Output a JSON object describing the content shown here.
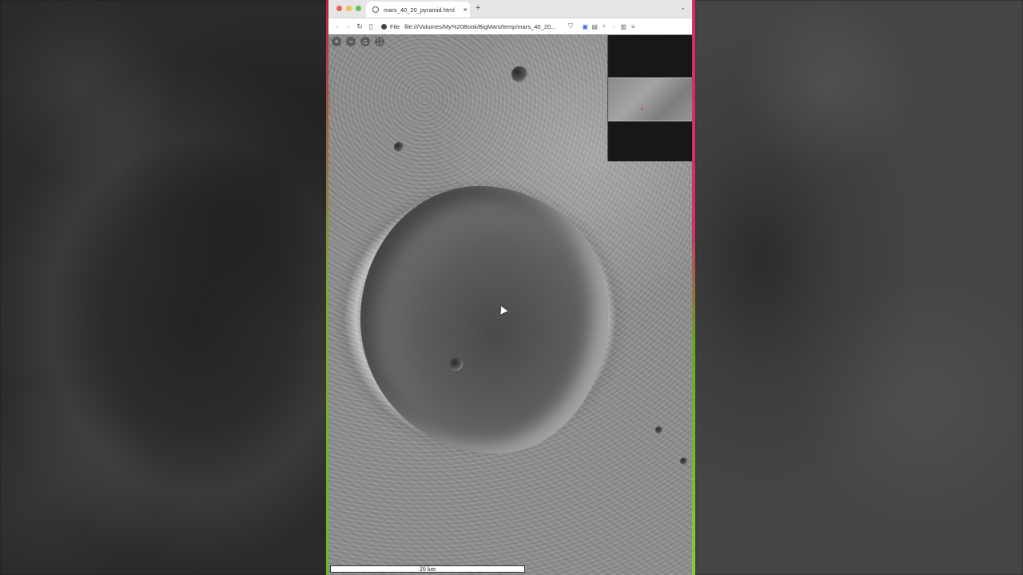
{
  "browser": {
    "tab_title": "mars_40_20_pyramid.html",
    "tab_close": "×",
    "new_tab": "+",
    "tab_menu": "⌄",
    "url_scheme": "File",
    "url": "file:///Volumes/My%20Book/BigMars/temp/mars_40_20..."
  },
  "map": {
    "zoom_controls": [
      "+",
      "−",
      "⌂",
      "⛶"
    ],
    "scale_label": "20 km"
  },
  "colors": {
    "close": "#ec5f57",
    "minimize": "#f4bd4f",
    "maximize": "#5fc454"
  }
}
